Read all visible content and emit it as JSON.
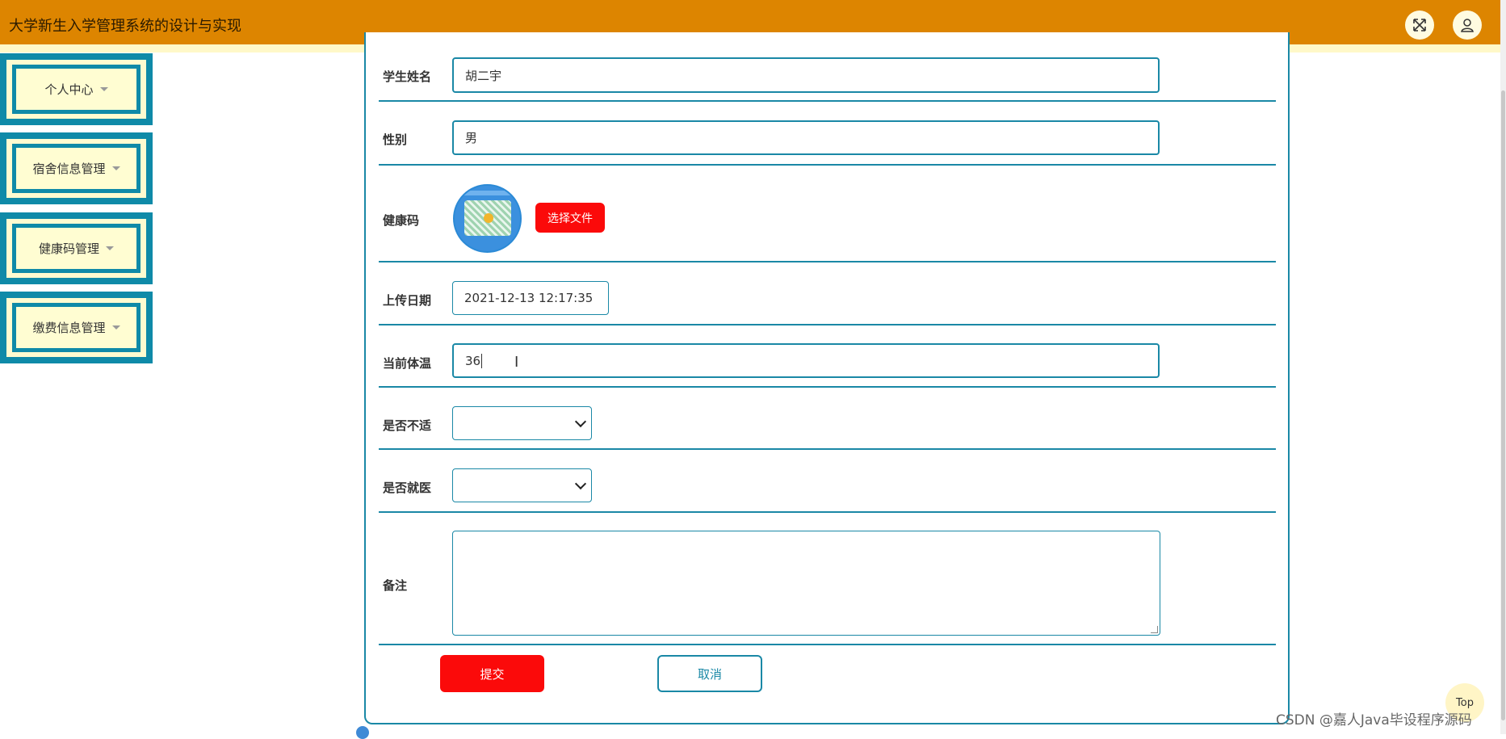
{
  "header": {
    "title": "大学新生入学管理系统的设计与实现",
    "fullscreen_icon": "expand-icon",
    "user_icon": "user-icon"
  },
  "sidebar": {
    "items": [
      {
        "label": "个人中心"
      },
      {
        "label": "宿舍信息管理"
      },
      {
        "label": "健康码管理"
      },
      {
        "label": "缴费信息管理"
      }
    ]
  },
  "form": {
    "student_name": {
      "label": "学生姓名",
      "value": "胡二宇"
    },
    "gender": {
      "label": "性别",
      "value": "男"
    },
    "health_code": {
      "label": "健康码",
      "button": "选择文件"
    },
    "upload_date": {
      "label": "上传日期",
      "value": "2021-12-13 12:17:35"
    },
    "temperature": {
      "label": "当前体温",
      "value": "36"
    },
    "discomfort": {
      "label": "是否不适",
      "value": ""
    },
    "medical": {
      "label": "是否就医",
      "value": ""
    },
    "remarks": {
      "label": "备注",
      "value": ""
    },
    "submit": "提交",
    "cancel": "取消"
  },
  "floating": {
    "top_label": "Top"
  },
  "watermark": "CSDN @嘉人Java毕设程序源码",
  "colors": {
    "header": "#dd8500",
    "accent": "#1a88a6",
    "danger": "#fb0a0a",
    "sidebar_bg": "#fffbd0"
  }
}
